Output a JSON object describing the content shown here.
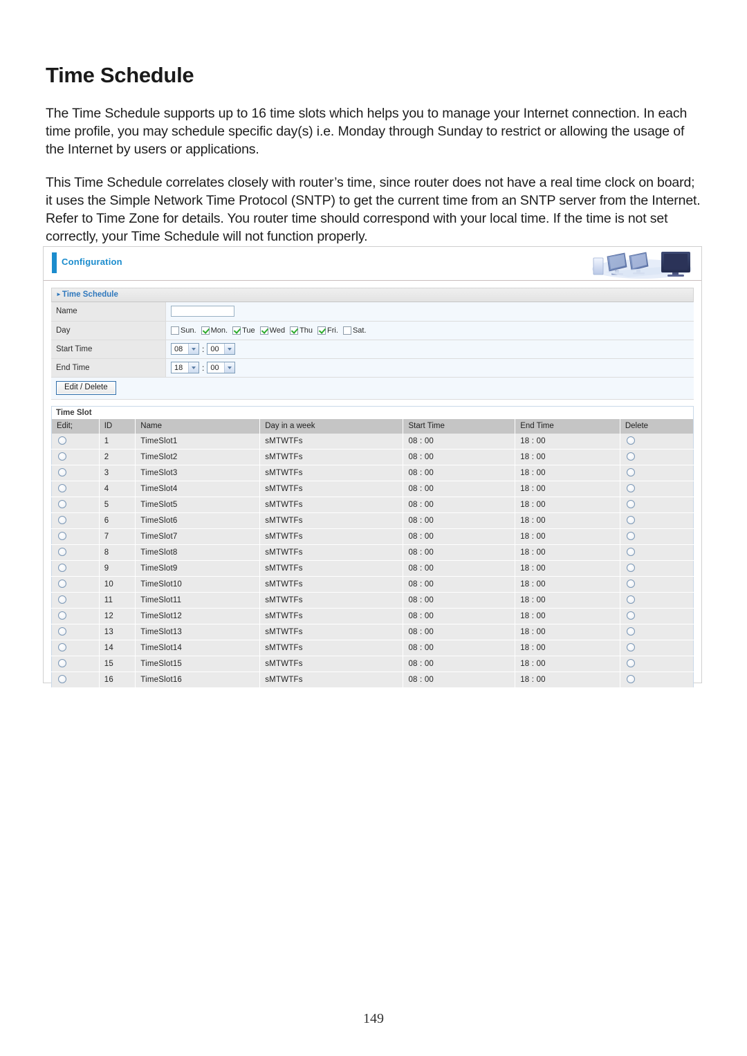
{
  "document": {
    "title": "Time Schedule",
    "paragraph_1": "The Time Schedule supports up to 16 time slots which helps you to manage your Internet connection.  In each time profile, you may schedule specific day(s) i.e. Monday through Sunday to restrict or allowing the usage of the Internet by users or applications.",
    "paragraph_2": "This Time Schedule correlates closely with router’s time, since router does not have a real time clock on board; it uses the Simple Network Time Protocol (SNTP) to get the current time from an SNTP server from the Internet. Refer to Time Zone for details.  You router time should correspond with your local time.  If the time is not set correctly, your Time Schedule will not function properly.",
    "page_number": "149"
  },
  "ui": {
    "header_title": "Configuration",
    "section_title": "Time Schedule",
    "accent_color": "#1b8ccd",
    "form": {
      "name_label": "Name",
      "name_value": "",
      "day_label": "Day",
      "days": [
        {
          "label": "Sun.",
          "checked": false
        },
        {
          "label": "Mon.",
          "checked": true
        },
        {
          "label": "Tue",
          "checked": true
        },
        {
          "label": "Wed",
          "checked": true
        },
        {
          "label": "Thu",
          "checked": true
        },
        {
          "label": "Fri.",
          "checked": true
        },
        {
          "label": "Sat.",
          "checked": false
        }
      ],
      "start_time_label": "Start Time",
      "start_hour": "08",
      "start_minute": "00",
      "end_time_label": "End Time",
      "end_hour": "18",
      "end_minute": "00",
      "separator": ":"
    },
    "edit_delete_button": "Edit / Delete",
    "slot_panel_title": "Time Slot",
    "slot_table": {
      "columns": [
        "Edit;",
        "ID",
        "Name",
        "Day in a week",
        "Start Time",
        "End Time",
        "Delete"
      ],
      "rows": [
        {
          "id": "1",
          "name": "TimeSlot1",
          "day": "sMTWTFs",
          "start": "08 : 00",
          "end": "18 : 00"
        },
        {
          "id": "2",
          "name": "TimeSlot2",
          "day": "sMTWTFs",
          "start": "08 : 00",
          "end": "18 : 00"
        },
        {
          "id": "3",
          "name": "TimeSlot3",
          "day": "sMTWTFs",
          "start": "08 : 00",
          "end": "18 : 00"
        },
        {
          "id": "4",
          "name": "TimeSlot4",
          "day": "sMTWTFs",
          "start": "08 : 00",
          "end": "18 : 00"
        },
        {
          "id": "5",
          "name": "TimeSlot5",
          "day": "sMTWTFs",
          "start": "08 : 00",
          "end": "18 : 00"
        },
        {
          "id": "6",
          "name": "TimeSlot6",
          "day": "sMTWTFs",
          "start": "08 : 00",
          "end": "18 : 00"
        },
        {
          "id": "7",
          "name": "TimeSlot7",
          "day": "sMTWTFs",
          "start": "08 : 00",
          "end": "18 : 00"
        },
        {
          "id": "8",
          "name": "TimeSlot8",
          "day": "sMTWTFs",
          "start": "08 : 00",
          "end": "18 : 00"
        },
        {
          "id": "9",
          "name": "TimeSlot9",
          "day": "sMTWTFs",
          "start": "08 : 00",
          "end": "18 : 00"
        },
        {
          "id": "10",
          "name": "TimeSlot10",
          "day": "sMTWTFs",
          "start": "08 : 00",
          "end": "18 : 00"
        },
        {
          "id": "11",
          "name": "TimeSlot11",
          "day": "sMTWTFs",
          "start": "08 : 00",
          "end": "18 : 00"
        },
        {
          "id": "12",
          "name": "TimeSlot12",
          "day": "sMTWTFs",
          "start": "08 : 00",
          "end": "18 : 00"
        },
        {
          "id": "13",
          "name": "TimeSlot13",
          "day": "sMTWTFs",
          "start": "08 : 00",
          "end": "18 : 00"
        },
        {
          "id": "14",
          "name": "TimeSlot14",
          "day": "sMTWTFs",
          "start": "08 : 00",
          "end": "18 : 00"
        },
        {
          "id": "15",
          "name": "TimeSlot15",
          "day": "sMTWTFs",
          "start": "08 : 00",
          "end": "18 : 00"
        },
        {
          "id": "16",
          "name": "TimeSlot16",
          "day": "sMTWTFs",
          "start": "08 : 00",
          "end": "18 : 00"
        }
      ]
    }
  }
}
